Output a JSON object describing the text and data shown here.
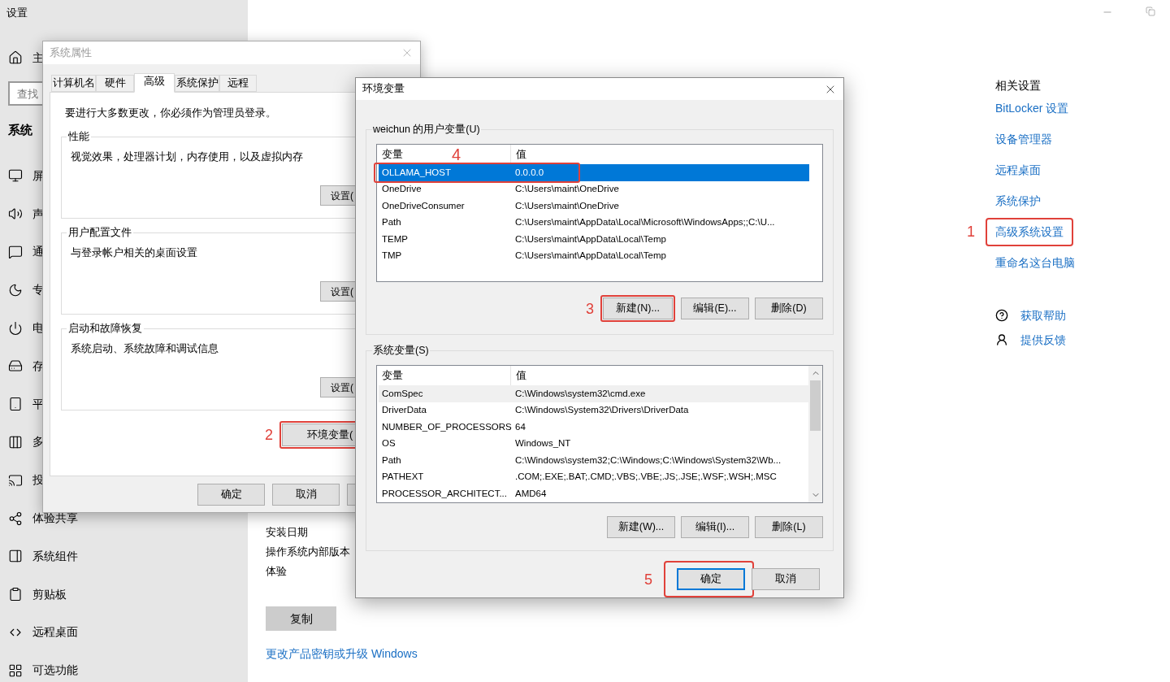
{
  "settings": {
    "title": "设置",
    "sidebar": {
      "home_label": "主",
      "search": {
        "placeholder": "查找"
      },
      "section": "系统",
      "items": [
        {
          "label": "屏"
        },
        {
          "label": "声"
        },
        {
          "label": "通"
        },
        {
          "label": "专"
        },
        {
          "label": "电"
        },
        {
          "label": "存"
        },
        {
          "label": "平"
        },
        {
          "label": "多"
        },
        {
          "label": "投"
        },
        {
          "label": "体验共享"
        },
        {
          "label": "系统组件"
        },
        {
          "label": "剪贴板"
        },
        {
          "label": "远程桌面"
        },
        {
          "label": "可选功能"
        }
      ]
    },
    "about": {
      "rows": [
        "安装日期",
        "操作系统内部版本",
        "体验"
      ],
      "copy_button": "复制",
      "link": "更改产品密钥或升级 Windows"
    },
    "related": {
      "title": "相关设置",
      "links": [
        {
          "label": "BitLocker 设置"
        },
        {
          "label": "设备管理器"
        },
        {
          "label": "远程桌面"
        },
        {
          "label": "系统保护"
        },
        {
          "label": "高级系统设置",
          "callout": "1"
        },
        {
          "label": "重命名这台电脑"
        }
      ],
      "help": [
        "获取帮助",
        "提供反馈"
      ]
    }
  },
  "system_properties": {
    "title": "系统属性",
    "tabs": [
      {
        "label": "计算机名",
        "selected": false
      },
      {
        "label": "硬件",
        "selected": false
      },
      {
        "label": "高级",
        "selected": true
      },
      {
        "label": "系统保护",
        "selected": false
      },
      {
        "label": "远程",
        "selected": false
      }
    ],
    "notice": "要进行大多数更改，你必须作为管理员登录。",
    "groups": [
      {
        "title": "性能",
        "text": "视觉效果，处理器计划，内存使用，以及虚拟内存",
        "button": "设置("
      },
      {
        "title": "用户配置文件",
        "text": "与登录帐户相关的桌面设置",
        "button": "设置("
      },
      {
        "title": "启动和故障恢复",
        "text": "系统启动、系统故障和调试信息",
        "button": "设置("
      }
    ],
    "env_button": {
      "label": "环境变量(",
      "callout": "2"
    },
    "buttons": [
      "确定",
      "取消"
    ]
  },
  "environment_variables": {
    "title": "环境变量",
    "lists": [
      {
        "title": "weichun 的用户变量(U)",
        "focused": true,
        "columns": [
          "变量",
          "值"
        ],
        "rows": [
          {
            "name": "OLLAMA_HOST",
            "value": "0.0.0.0",
            "selected": true,
            "callout": "4"
          },
          {
            "name": "OneDrive",
            "value": "C:\\Users\\maint\\OneDrive",
            "selected": false
          },
          {
            "name": "OneDriveConsumer",
            "value": "C:\\Users\\maint\\OneDrive",
            "selected": false
          },
          {
            "name": "Path",
            "value": "C:\\Users\\maint\\AppData\\Local\\Microsoft\\WindowsApps;;C:\\U...",
            "selected": false
          },
          {
            "name": "TEMP",
            "value": "C:\\Users\\maint\\AppData\\Local\\Temp",
            "selected": false
          },
          {
            "name": "TMP",
            "value": "C:\\Users\\maint\\AppData\\Local\\Temp",
            "selected": false
          }
        ],
        "buttons": [
          {
            "label": "新建(N)...",
            "callout": "3"
          },
          {
            "label": "编辑(E)..."
          },
          {
            "label": "删除(D)"
          }
        ]
      },
      {
        "title": "系统变量(S)",
        "focused": false,
        "columns": [
          "变量",
          "值"
        ],
        "rows": [
          {
            "name": "ComSpec",
            "value": "C:\\Windows\\system32\\cmd.exe",
            "selected": true
          },
          {
            "name": "DriverData",
            "value": "C:\\Windows\\System32\\Drivers\\DriverData",
            "selected": false
          },
          {
            "name": "NUMBER_OF_PROCESSORS",
            "value": "64",
            "selected": false
          },
          {
            "name": "OS",
            "value": "Windows_NT",
            "selected": false
          },
          {
            "name": "Path",
            "value": "C:\\Windows\\system32;C:\\Windows;C:\\Windows\\System32\\Wb...",
            "selected": false
          },
          {
            "name": "PATHEXT",
            "value": ".COM;.EXE;.BAT;.CMD;.VBS;.VBE;.JS;.JSE;.WSF;.WSH;.MSC",
            "selected": false
          },
          {
            "name": "PROCESSOR_ARCHITECT...",
            "value": "AMD64",
            "selected": false
          }
        ],
        "buttons": [
          {
            "label": "新建(W)..."
          },
          {
            "label": "编辑(I)..."
          },
          {
            "label": "删除(L)"
          }
        ]
      }
    ],
    "buttons": [
      {
        "label": "确定",
        "default": true,
        "callout": "5"
      },
      {
        "label": "取消",
        "default": false
      }
    ]
  }
}
